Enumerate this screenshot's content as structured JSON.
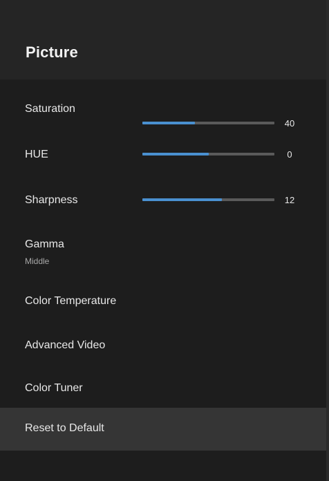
{
  "header": {
    "title": "Picture"
  },
  "settings": {
    "saturation": {
      "label": "Saturation",
      "value": "40",
      "level": 0.4
    },
    "hue": {
      "label": "HUE",
      "value": "0",
      "level": 0.5
    },
    "sharpness": {
      "label": "Sharpness",
      "value": "12",
      "level": 0.6
    },
    "gamma": {
      "label": "Gamma",
      "value": "Middle"
    },
    "color_temperature": {
      "label": "Color Temperature"
    },
    "advanced_video": {
      "label": "Advanced Video"
    },
    "color_tuner": {
      "label": "Color Tuner"
    },
    "reset": {
      "label": "Reset to Default",
      "selected": true
    }
  },
  "colors": {
    "slider_fill": "#4a90d0",
    "slider_track": "#5a5a5a",
    "selected_row": "#353535"
  }
}
